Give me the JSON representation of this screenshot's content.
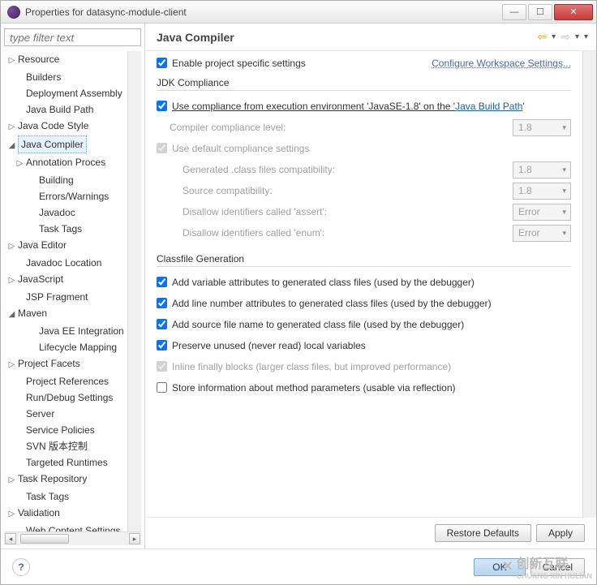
{
  "window": {
    "title": "Properties for datasync-module-client",
    "min": "—",
    "max": "☐",
    "close": "✕"
  },
  "filter_placeholder": "type filter text",
  "tree": [
    {
      "label": "Resource",
      "expand": "closed",
      "indent": 0
    },
    {
      "label": "Builders",
      "expand": "none",
      "indent": 1
    },
    {
      "label": "Deployment Assembly",
      "expand": "none",
      "indent": 1
    },
    {
      "label": "Java Build Path",
      "expand": "none",
      "indent": 1
    },
    {
      "label": "Java Code Style",
      "expand": "closed",
      "indent": 0
    },
    {
      "label": "Java Compiler",
      "expand": "open",
      "indent": 0,
      "selected": true
    },
    {
      "label": "Annotation Proces",
      "expand": "closed",
      "indent": 1
    },
    {
      "label": "Building",
      "expand": "none",
      "indent": 2
    },
    {
      "label": "Errors/Warnings",
      "expand": "none",
      "indent": 2
    },
    {
      "label": "Javadoc",
      "expand": "none",
      "indent": 2
    },
    {
      "label": "Task Tags",
      "expand": "none",
      "indent": 2
    },
    {
      "label": "Java Editor",
      "expand": "closed",
      "indent": 0
    },
    {
      "label": "Javadoc Location",
      "expand": "none",
      "indent": 1
    },
    {
      "label": "JavaScript",
      "expand": "closed",
      "indent": 0
    },
    {
      "label": "JSP Fragment",
      "expand": "none",
      "indent": 1
    },
    {
      "label": "Maven",
      "expand": "open",
      "indent": 0
    },
    {
      "label": "Java EE Integration",
      "expand": "none",
      "indent": 2
    },
    {
      "label": "Lifecycle Mapping",
      "expand": "none",
      "indent": 2
    },
    {
      "label": "Project Facets",
      "expand": "closed",
      "indent": 0
    },
    {
      "label": "Project References",
      "expand": "none",
      "indent": 1
    },
    {
      "label": "Run/Debug Settings",
      "expand": "none",
      "indent": 1
    },
    {
      "label": "Server",
      "expand": "none",
      "indent": 1
    },
    {
      "label": "Service Policies",
      "expand": "none",
      "indent": 1
    },
    {
      "label": "SVN 版本控制",
      "expand": "none",
      "indent": 1
    },
    {
      "label": "Targeted Runtimes",
      "expand": "none",
      "indent": 1
    },
    {
      "label": "Task Repository",
      "expand": "closed",
      "indent": 0
    },
    {
      "label": "Task Tags",
      "expand": "none",
      "indent": 1
    },
    {
      "label": "Validation",
      "expand": "closed",
      "indent": 0
    },
    {
      "label": "Web Content Settings",
      "expand": "none",
      "indent": 1
    }
  ],
  "page": {
    "title": "Java Compiler",
    "enable_project": "Enable project specific settings",
    "configure_link": "Configure Workspace Settings...",
    "jdk_group": "JDK Compliance",
    "use_compliance_pre": "Use compliance from execution environment 'JavaSE-1.8' on the '",
    "use_compliance_link": "Java Build Path",
    "use_compliance_post": "'",
    "compiler_level_lbl": "Compiler compliance level:",
    "compiler_level_val": "1.8",
    "use_default": "Use default compliance settings",
    "gen_class_lbl": "Generated .class files compatibility:",
    "gen_class_val": "1.8",
    "source_compat_lbl": "Source compatibility:",
    "source_compat_val": "1.8",
    "disallow_assert_lbl": "Disallow identifiers called 'assert':",
    "disallow_assert_val": "Error",
    "disallow_enum_lbl": "Disallow identifiers called 'enum':",
    "disallow_enum_val": "Error",
    "classfile_group": "Classfile Generation",
    "cf1": "Add variable attributes to generated class files (used by the debugger)",
    "cf2": "Add line number attributes to generated class files (used by the debugger)",
    "cf3": "Add source file name to generated class file (used by the debugger)",
    "cf4": "Preserve unused (never read) local variables",
    "cf5": "Inline finally blocks (larger class files, but improved performance)",
    "cf6": "Store information about method parameters (usable via reflection)",
    "restore": "Restore Defaults",
    "apply": "Apply",
    "ok": "OK",
    "cancel": "Cancel",
    "help": "?"
  },
  "watermark": {
    "main": "创新互联",
    "sub": "CHUANG XIN HULIAN"
  }
}
